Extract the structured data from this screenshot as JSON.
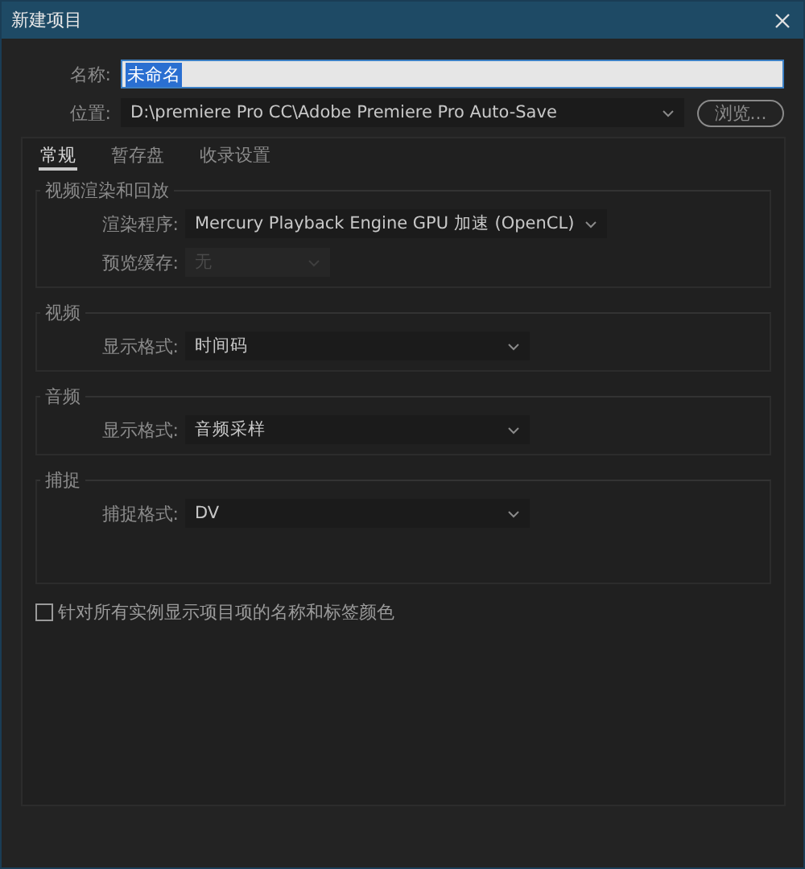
{
  "window": {
    "title": "新建项目"
  },
  "name_field": {
    "label": "名称:",
    "value": "未命名",
    "selected": true
  },
  "location": {
    "label": "位置:",
    "value": "D:\\premiere Pro CC\\Adobe Premiere Pro Auto-Save",
    "button": "浏览..."
  },
  "tabs": [
    {
      "label": "常规",
      "selected": true
    },
    {
      "label": "暂存盘",
      "selected": false
    },
    {
      "label": "收录设置",
      "selected": false
    }
  ],
  "sections": [
    {
      "title": "视频渲染和回放",
      "rows": [
        {
          "label": "渲染程序:",
          "value": "Mercury Playback Engine GPU 加速 (OpenCL)",
          "disabled": false
        },
        {
          "label": "预览缓存:",
          "value": "无",
          "disabled": true
        }
      ]
    },
    {
      "title": "视频",
      "rows": [
        {
          "label": "显示格式:",
          "value": "时间码",
          "disabled": false
        }
      ]
    },
    {
      "title": "音频",
      "rows": [
        {
          "label": "显示格式:",
          "value": "音频采样",
          "disabled": false
        }
      ]
    },
    {
      "title": "捕捉",
      "rows": [
        {
          "label": "捕捉格式:",
          "value": "DV",
          "disabled": false
        }
      ]
    }
  ],
  "checkbox": {
    "label": "针对所有实例显示项目项的名称和标签颜色",
    "checked": false
  }
}
